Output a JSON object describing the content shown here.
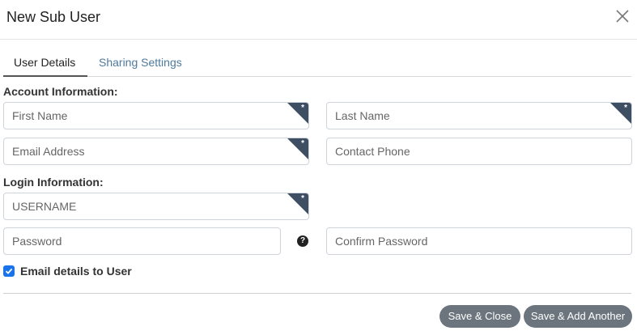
{
  "modal": {
    "title": "New Sub User"
  },
  "tabs": [
    {
      "label": "User Details"
    },
    {
      "label": "Sharing Settings"
    }
  ],
  "sections": {
    "account": "Account Information:",
    "login": "Login Information:"
  },
  "fields": {
    "first_name": {
      "placeholder": "First Name",
      "value": "",
      "required": true
    },
    "last_name": {
      "placeholder": "Last Name",
      "value": "",
      "required": true
    },
    "email": {
      "placeholder": "Email Address",
      "value": "",
      "required": true
    },
    "phone": {
      "placeholder": "Contact Phone",
      "value": "",
      "required": false
    },
    "username": {
      "placeholder": "USERNAME",
      "value": "",
      "required": true
    },
    "password": {
      "placeholder": "Password",
      "value": ""
    },
    "confirm_password": {
      "placeholder": "Confirm Password",
      "value": ""
    }
  },
  "required_marker": "*",
  "help_glyph": "?",
  "email_details": {
    "label": "Email details to User",
    "checked": true
  },
  "buttons": {
    "save_close": "Save & Close",
    "save_add": "Save & Add Another"
  },
  "colors": {
    "required_corner": "#3f4f63",
    "checkbox": "#1a73e8",
    "button": "#6c757d",
    "inactive_tab": "#4e7a9c"
  },
  "icons": {
    "close": "close-icon",
    "help": "question-circle-icon",
    "check": "checkmark-icon"
  }
}
